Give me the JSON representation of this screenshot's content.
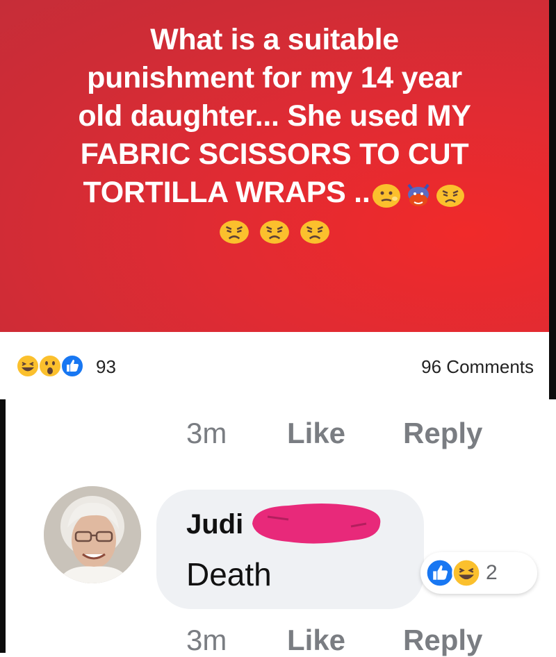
{
  "post": {
    "text_lines": [
      "What is a suitable",
      "punishment for my 14 year",
      "old daughter... She used MY",
      "FABRIC SCISSORS TO CUT",
      "TORTILLA WRAPS .."
    ],
    "inline_emojis": [
      "confused-face-icon",
      "devil-icon",
      "angry-face-icon"
    ],
    "emoji_row": [
      "angry-face-icon",
      "angry-face-icon",
      "angry-face-icon"
    ],
    "background_color": "#d42c35",
    "text_color": "#ffffff"
  },
  "post_reactions": {
    "icons": [
      "laugh-icon",
      "wow-icon",
      "like-icon"
    ],
    "count": "93",
    "comments": "96 Comments"
  },
  "comment_actions_top": {
    "time": "3m",
    "like": "Like",
    "reply": "Reply"
  },
  "comment": {
    "author": "Judi",
    "text": "Death",
    "reactions": {
      "icons": [
        "like-icon",
        "laugh-icon"
      ],
      "count": "2"
    },
    "redaction_color": "#e8297a"
  },
  "comment_actions_bottom": {
    "time": "3m",
    "like": "Like",
    "reply": "Reply"
  }
}
